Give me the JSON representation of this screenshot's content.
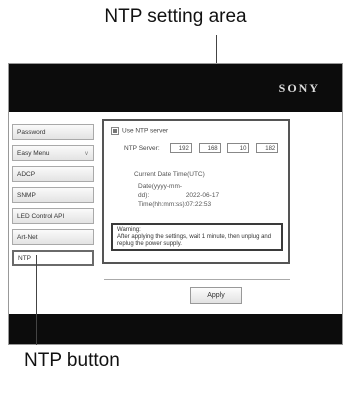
{
  "annotations": {
    "top_label": "NTP setting area",
    "bottom_label": "NTP button"
  },
  "header": {
    "brand": "SONY"
  },
  "sidebar": {
    "items": [
      {
        "label": "Password",
        "caret": ""
      },
      {
        "label": "Easy Menu",
        "caret": "v"
      },
      {
        "label": "ADCP",
        "caret": ""
      },
      {
        "label": "SNMP",
        "caret": ""
      },
      {
        "label": "LED Control API",
        "caret": ""
      },
      {
        "label": "Art-Net",
        "caret": ""
      },
      {
        "label": "NTP",
        "caret": ""
      }
    ],
    "active": "NTP"
  },
  "ntp": {
    "use_ntp_label": "Use NTP server",
    "use_ntp_checked": true,
    "server_label": "NTP Server:",
    "server_ip": [
      "192",
      "168",
      "10",
      "182"
    ],
    "time_title": "Current Date Time(UTC)",
    "date_label": "Date(yyyy-mm-dd):",
    "date_value": "2022-06-17",
    "time_label": "Time(hh:mm:ss):",
    "time_value": "07:22:53",
    "warning_title": "Warning:",
    "warning_text": "After applying the settings, wait 1 minute, then unplug and replug the power supply."
  },
  "actions": {
    "apply_label": "Apply"
  }
}
